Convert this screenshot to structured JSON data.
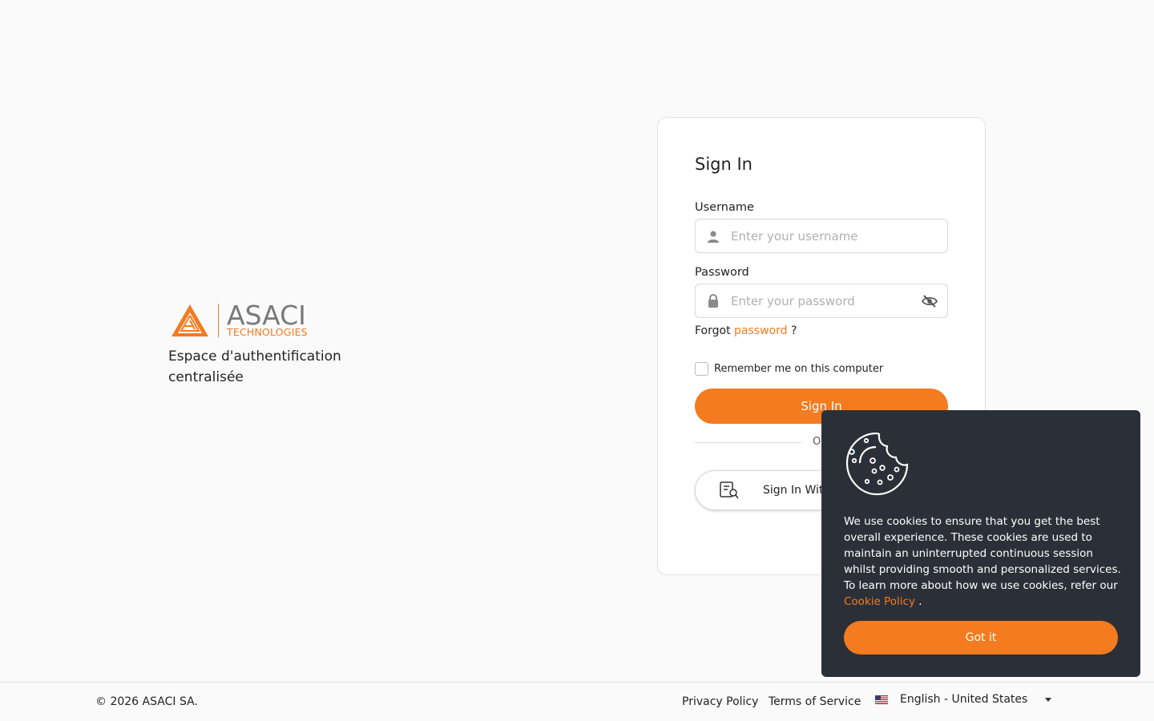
{
  "brand": {
    "logo_word": "ASACI",
    "logo_sub": "TECHNOLOGIES",
    "tagline": "Espace d'authentification centralisée",
    "colors": {
      "accent": "#f47b20",
      "logo_gray": "#7a7a7a"
    }
  },
  "login": {
    "title": "Sign In",
    "username_label": "Username",
    "username_placeholder": "Enter your username",
    "username_icon": "user-icon",
    "password_label": "Password",
    "password_placeholder": "Enter your password",
    "password_icon": "lock-icon",
    "toggle_icon": "eye-slash-icon",
    "forgot_prefix": "Forgot",
    "forgot_link": "password",
    "forgot_suffix": "?",
    "remember_label": "Remember me on this computer",
    "signin_button": "Sign In",
    "or_text": "OR",
    "sso_button": "Sign In With SSO",
    "sso_icon": "sso-icon"
  },
  "cookie": {
    "icon": "cookie-icon",
    "text_before": "We use cookies to ensure that you get the best overall experience. These cookies are used to maintain an uninterrupted continuous session whilst providing smooth and personalized services. To learn more about how we use cookies, refer our",
    "policy_link": "Cookie Policy",
    "text_after": ".",
    "button": "Got it",
    "bg_color": "#2b3038"
  },
  "footer": {
    "copyright": "© 2026 ASACI SA.",
    "privacy": "Privacy Policy",
    "terms": "Terms of Service",
    "language": "English - United States",
    "flag_icon": "us-flag-icon"
  }
}
